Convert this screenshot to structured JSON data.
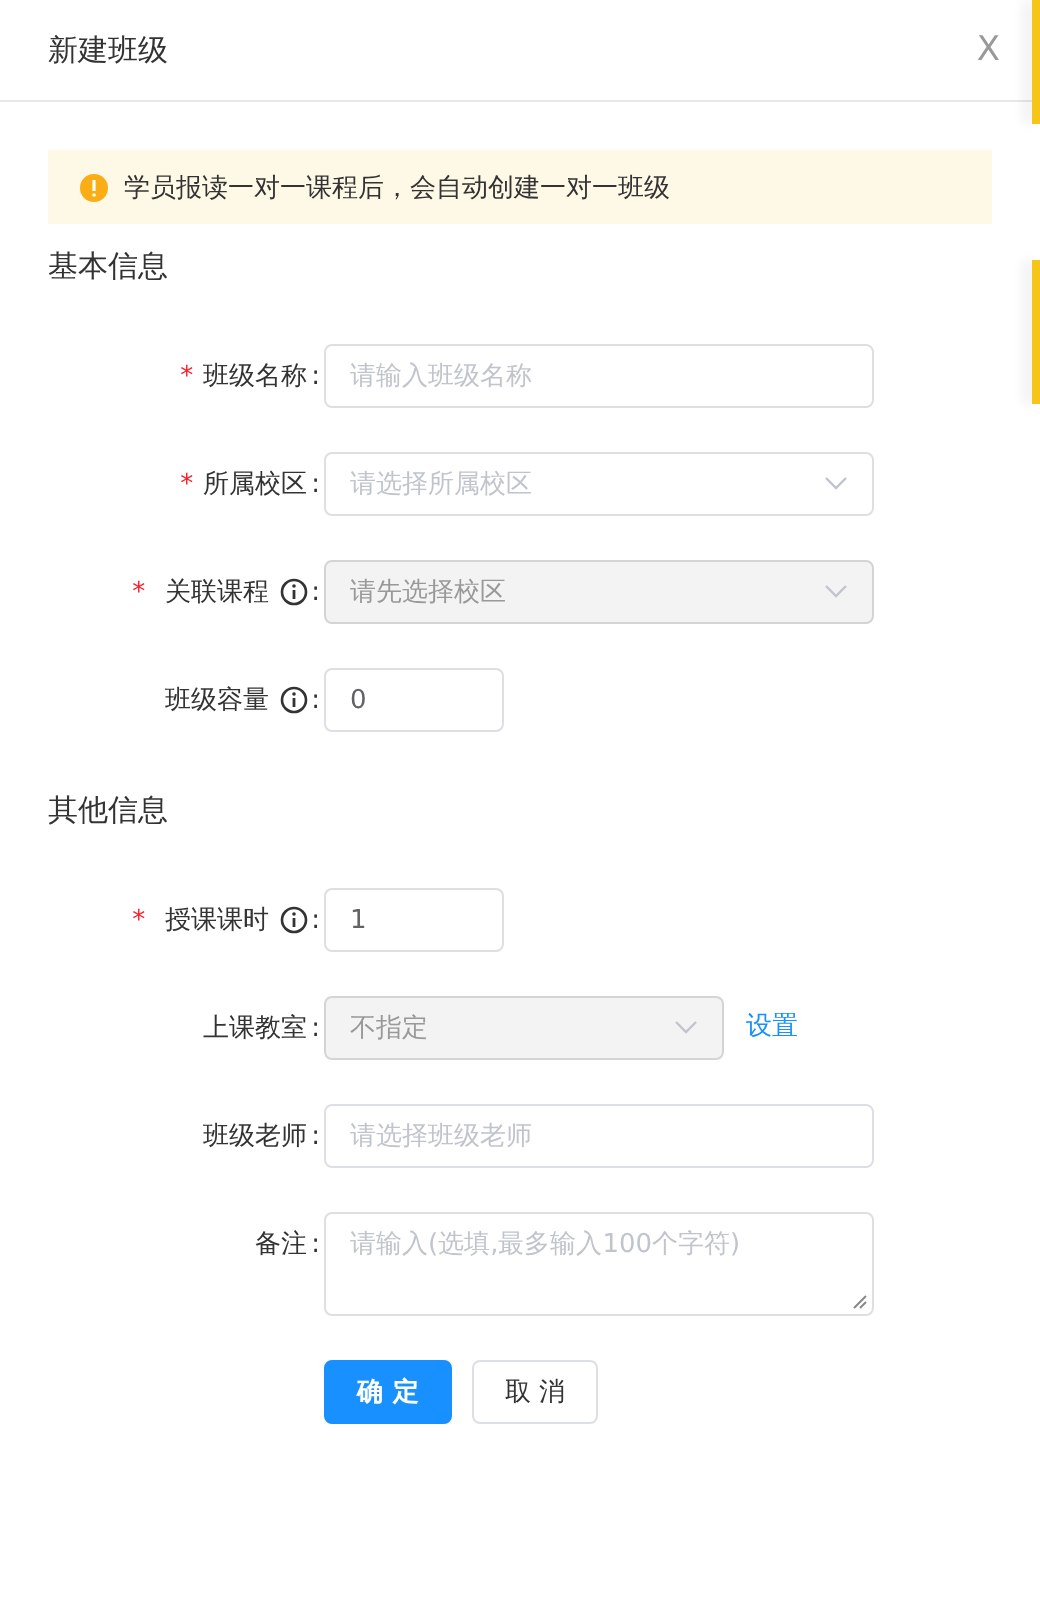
{
  "dialog": {
    "title": "新建班级",
    "close": "X"
  },
  "alert": {
    "text": "学员报读一对一课程后，会自动创建一对一班级"
  },
  "sections": [
    {
      "title": "基本信息",
      "fields": [
        {
          "kind": "input",
          "mark": "*",
          "label": "班级名称",
          "info": false,
          "colon": ":",
          "placeholder": "请输入班级名称",
          "disabled": false
        },
        {
          "kind": "select",
          "mark": "*",
          "label": "所属校区",
          "info": false,
          "colon": ":",
          "placeholder": "请选择所属校区",
          "disabled": false
        },
        {
          "kind": "select",
          "mark": "*",
          "label": "关联课程",
          "info": true,
          "colon": ":",
          "placeholder": "请先选择校区",
          "disabled": true
        },
        {
          "kind": "input",
          "label": "班级容量",
          "info": true,
          "colon": ":",
          "value": "0",
          "disabled": false
        }
      ]
    },
    {
      "title": "其他信息",
      "fields": [
        {
          "kind": "input",
          "mark": "*",
          "label": "授课课时",
          "info": true,
          "colon": ":",
          "value": "1",
          "disabled": false
        },
        {
          "kind": "select",
          "label": "上课教室",
          "info": false,
          "colon": ":",
          "placeholder": "不指定",
          "disabled": true,
          "link": "设置"
        },
        {
          "kind": "input",
          "label": "班级老师",
          "info": false,
          "colon": ":",
          "placeholder": "请选择班级老师",
          "disabled": false
        },
        {
          "kind": "textarea",
          "label": "备注",
          "info": false,
          "colon": ":",
          "placeholder": "请输入(选填,最多输入100个字符)",
          "disabled": false
        }
      ]
    }
  ],
  "buttons": [
    {
      "label": "确 定",
      "kind": "primary"
    },
    {
      "label": "取 消",
      "kind": "default"
    }
  ]
}
